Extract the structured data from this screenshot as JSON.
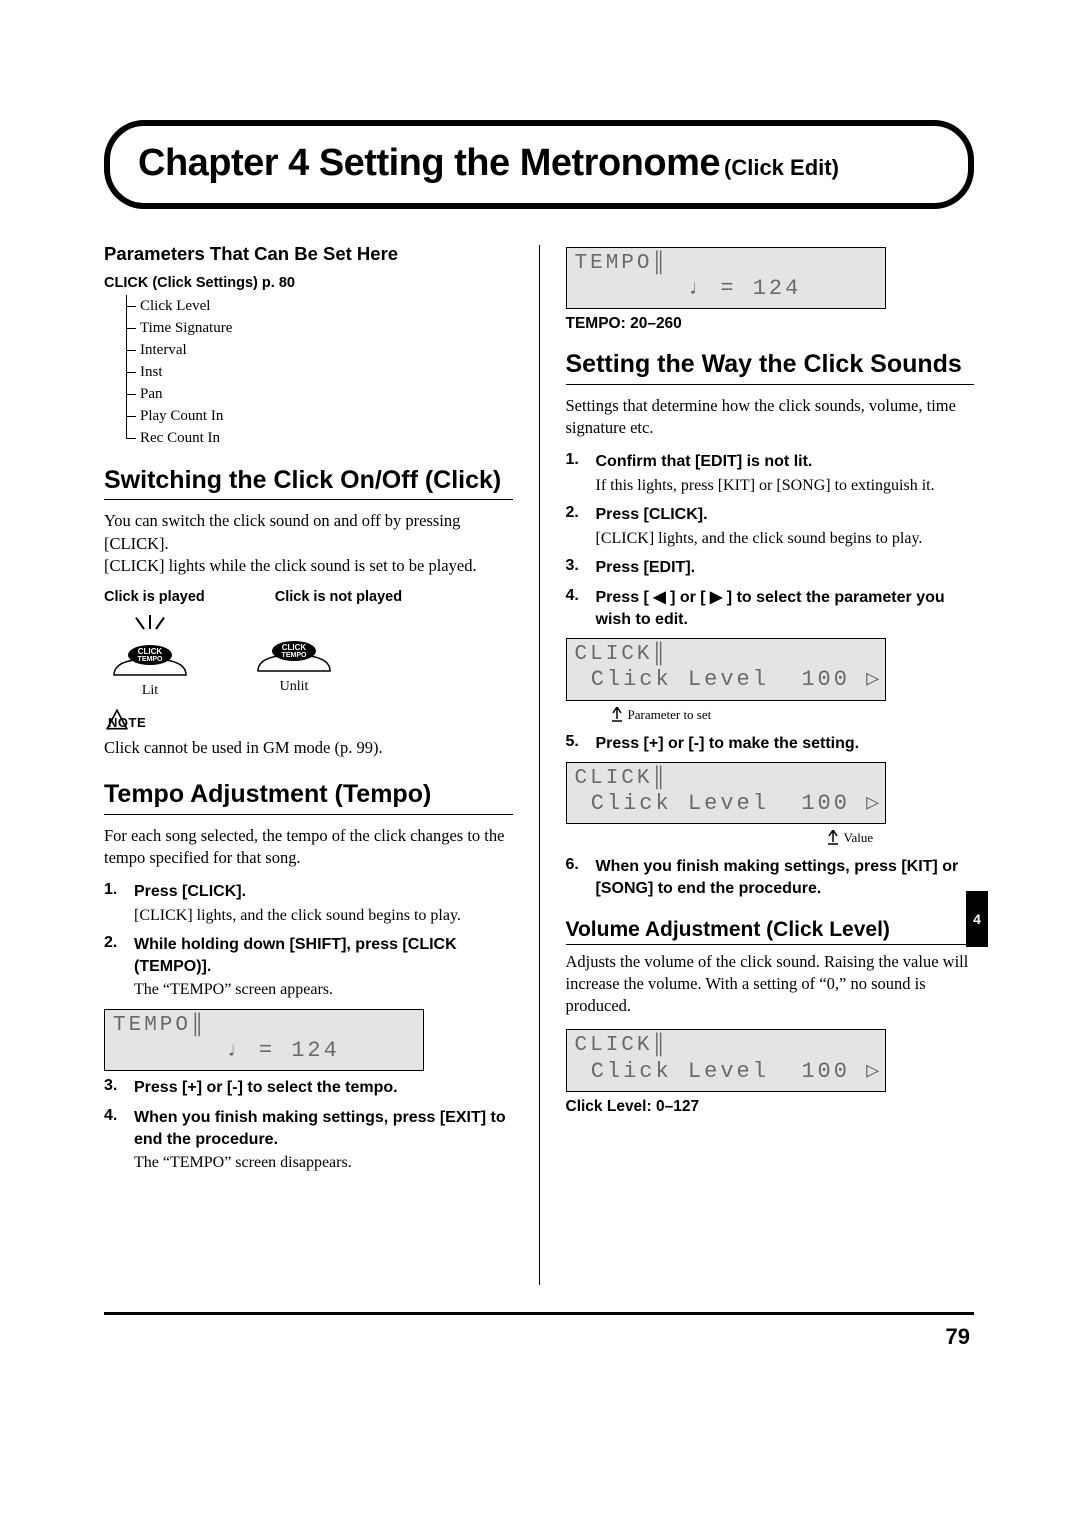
{
  "chapter": {
    "title": "Chapter 4 Setting the Metronome",
    "subtitle": "(Click Edit)"
  },
  "left": {
    "params_heading": "Parameters That Can Be Set Here",
    "click_settings_label": "CLICK (Click Settings) p. 80",
    "tree": [
      "Click Level",
      "Time Signature",
      "Interval",
      "Inst",
      "Pan",
      "Play Count In",
      "Rec Count In"
    ],
    "switch_heading": "Switching the Click On/Off (Click)",
    "switch_body1": "You can switch the click sound on and off by pressing [CLICK].",
    "switch_body2": "[CLICK] lights while the click sound is set to be played.",
    "played_label": "Click is played",
    "not_played_label": "Click is not played",
    "btn_click": "CLICK",
    "btn_tempo": "TEMPO",
    "lit": "Lit",
    "unlit": "Unlit",
    "note_label": "NOTE",
    "note_text": "Click cannot be used in GM mode (p. 99).",
    "tempo_heading": "Tempo Adjustment (Tempo)",
    "tempo_body": "For each song selected, the tempo of the click changes to the tempo specified for that song.",
    "step1_b": "Press [CLICK].",
    "step1_n": "[CLICK] lights, and the click sound begins to play.",
    "step2_b": "While holding down [SHIFT], press [CLICK (TEMPO)].",
    "step2_n": "The “TEMPO” screen appears.",
    "lcd_tempo_line1": "TEMPO║",
    "lcd_tempo_line2": "       ♩ = 124",
    "step3_b": "Press [+] or [-] to select the tempo.",
    "step4_b": "When you finish making settings, press [EXIT] to end the procedure.",
    "step4_n": "The “TEMPO” screen disappears."
  },
  "right": {
    "lcd_tempo_line1": "TEMPO║",
    "lcd_tempo_line2": "       ♩ = 124",
    "tempo_range": "TEMPO: 20–260",
    "sounds_heading": "Setting the Way the Click Sounds",
    "sounds_body": "Settings that determine how the click sounds, volume, time signature etc.",
    "s1_b": "Confirm that [EDIT] is not lit.",
    "s1_n": "If this lights, press [KIT] or [SONG] to extinguish it.",
    "s2_b": "Press [CLICK].",
    "s2_n": "[CLICK] lights, and the click sound begins to play.",
    "s3_b": "Press [EDIT].",
    "s4_b": "Press [ ◀ ] or [ ▶ ] to select the parameter you wish to edit.",
    "lcd_click_line1": "CLICK║",
    "lcd_click_line2": " Click Level  100 ▷",
    "param_note": "Parameter to set",
    "s5_b": "Press [+] or [-] to make the setting.",
    "value_note": "Value",
    "s6_b": "When you finish making settings, press [KIT] or [SONG] to end the procedure.",
    "vol_heading": "Volume Adjustment (Click Level)",
    "vol_body": "Adjusts the volume of the click sound. Raising the value will increase the volume. With a setting of “0,” no sound is produced.",
    "click_range": "Click Level: 0–127"
  },
  "side_tab": "4",
  "page_number": "79"
}
